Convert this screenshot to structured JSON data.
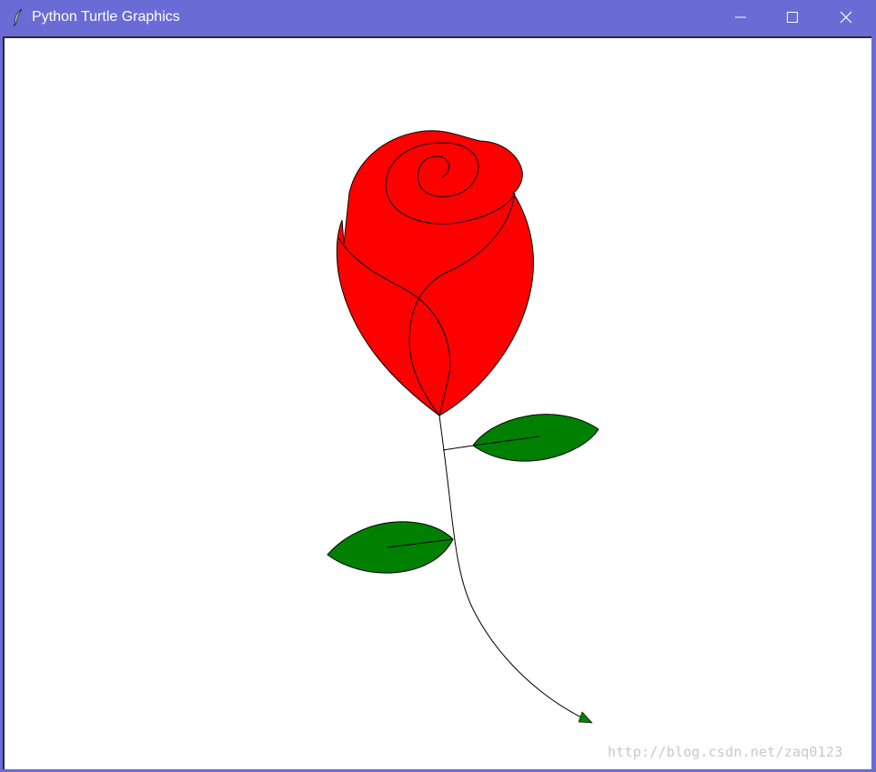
{
  "window": {
    "title": "Python Turtle Graphics",
    "titlebar_color": "#6b6bd6",
    "icons": {
      "app": "feather-icon",
      "minimize": "minimize-icon",
      "maximize": "maximize-icon",
      "close": "close-icon"
    }
  },
  "drawing": {
    "subject": "rose",
    "colors": {
      "petal_fill": "#ff0000",
      "leaf_fill": "#008000",
      "outline": "#000000",
      "turtle": "#008000"
    }
  },
  "watermark": {
    "text": "http://blog.csdn.net/zaq0123"
  }
}
